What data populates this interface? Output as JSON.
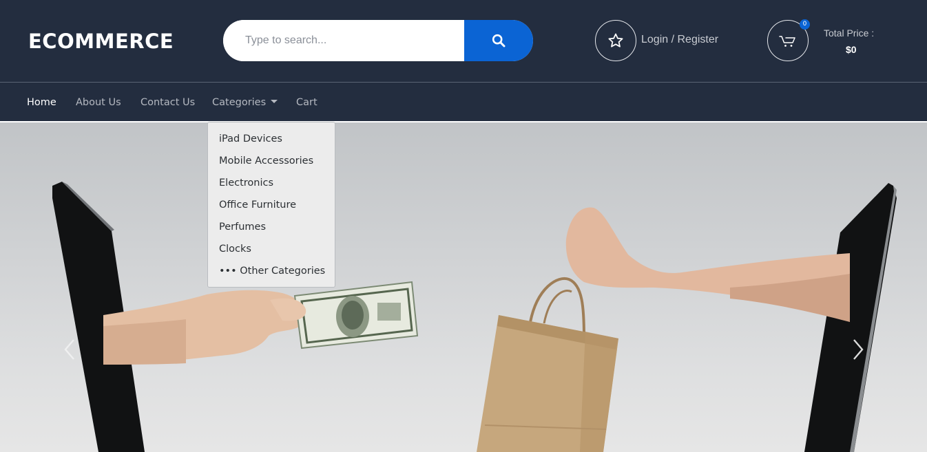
{
  "brand": {
    "logo_text": "ECOMMERCE"
  },
  "search": {
    "placeholder": "Type to search...",
    "value": ""
  },
  "account": {
    "login_text": "Login / Register"
  },
  "cart": {
    "count": "0",
    "total_label": "Total Price :",
    "total_value": "$0"
  },
  "nav": {
    "items": [
      {
        "label": "Home",
        "active": true
      },
      {
        "label": "About Us",
        "active": false
      },
      {
        "label": "Contact Us",
        "active": false
      },
      {
        "label": "Categories",
        "active": false
      },
      {
        "label": "Cart",
        "active": false
      }
    ]
  },
  "categories_dropdown": {
    "items": [
      {
        "label": "iPad Devices"
      },
      {
        "label": "Mobile Accessories"
      },
      {
        "label": "Electronics"
      },
      {
        "label": "Office Furniture"
      },
      {
        "label": "Perfumes"
      },
      {
        "label": "Clocks"
      },
      {
        "label": "••• Other Categories"
      }
    ]
  },
  "icons": {
    "search": "search-icon",
    "wishlist": "star-icon",
    "cart": "cart-icon",
    "carousel_prev": "chevron-left-icon",
    "carousel_next": "chevron-right-icon"
  },
  "colors": {
    "header_bg": "#232d3f",
    "accent": "#0b64d4",
    "nav_text": "#b5b9c1",
    "dropdown_bg": "#ececec"
  }
}
